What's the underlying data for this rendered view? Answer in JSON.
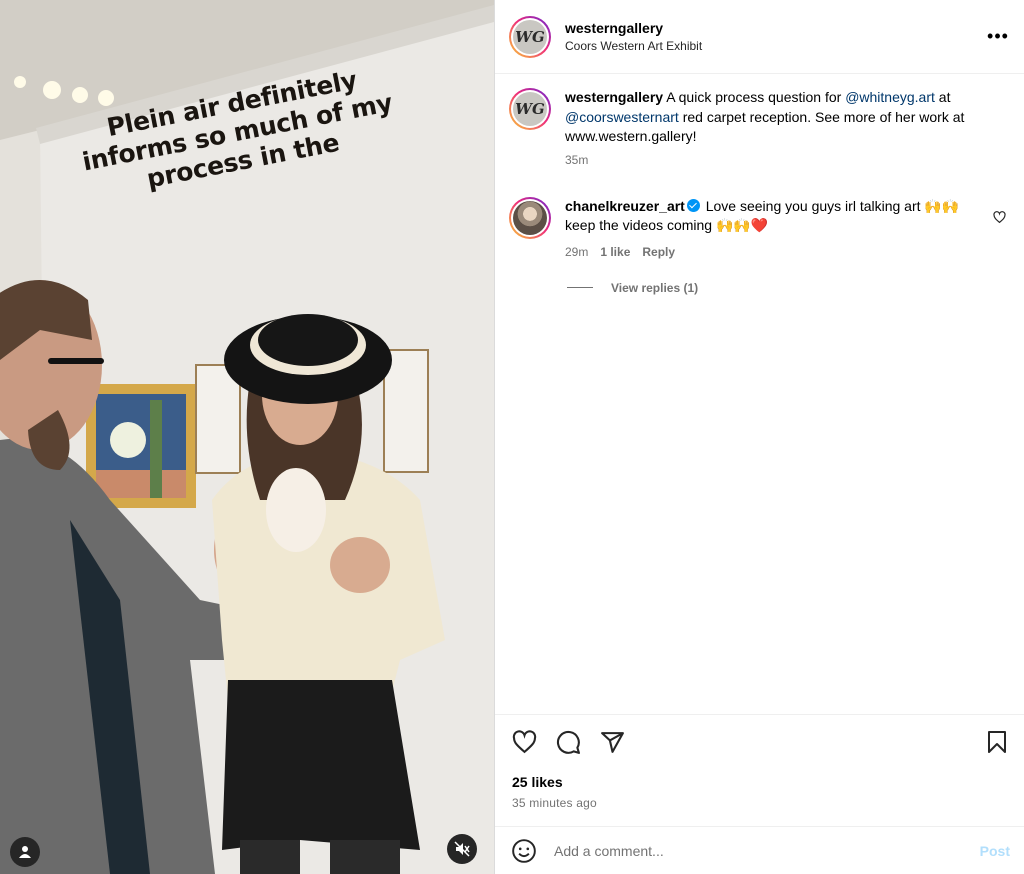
{
  "post": {
    "username": "westerngallery",
    "location": "Coors Western Art Exhibit",
    "avatar_text": "WG",
    "video_caption": "Plein air definitely informs so much of my process in the"
  },
  "caption_comment": {
    "username": "westerngallery",
    "text_1": "A quick process question for",
    "mention_1": "@whitneyg.art",
    "text_2": "at",
    "mention_2": "@coorswesternart",
    "text_3": "red carpet reception. See more of her work at www.western.gallery!",
    "time": "35m"
  },
  "comments": [
    {
      "username": "chanelkreuzer_art",
      "verified": true,
      "text": "Love seeing you guys irl talking art 🙌🙌keep the videos coming 🙌🙌❤️",
      "time": "29m",
      "likes": "1 like",
      "reply_label": "Reply",
      "view_replies": "View replies (1)"
    }
  ],
  "actions": {
    "likes": "25 likes",
    "posted_ago": "35 minutes ago"
  },
  "add_comment": {
    "placeholder": "Add a comment...",
    "post_label": "Post"
  },
  "icons": {
    "more": "more-options-icon",
    "like": "heart-icon",
    "comment": "comment-icon",
    "share": "share-icon",
    "save": "bookmark-icon",
    "emoji": "emoji-icon",
    "tag": "person-tag-icon",
    "mute": "muted-audio-icon"
  },
  "colors": {
    "mention": "#00376b",
    "meta": "#737373",
    "post_disabled": "#b2dffc",
    "verified": "#0095f6"
  }
}
